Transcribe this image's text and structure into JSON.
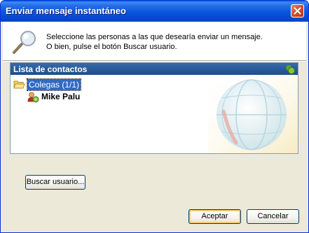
{
  "window": {
    "title": "Enviar mensaje instantáneo"
  },
  "instructions": {
    "line1": "Seleccione las personas a las que desearía enviar un mensaje.",
    "line2": "O bien, pulse el botón Buscar usuario."
  },
  "contacts": {
    "header": "Lista de contactos",
    "groups": [
      {
        "label": "Colegas (1/1)",
        "contacts": [
          {
            "name": "Mike Palu"
          }
        ]
      }
    ]
  },
  "buttons": {
    "search": "Buscar usuario...",
    "accept": "Aceptar",
    "cancel": "Cancelar"
  },
  "colors": {
    "titlebar": "#0855dd",
    "panel_header": "#2a5a9a",
    "selection": "#316ac5",
    "dialog_bg": "#ece9d8"
  },
  "icons": [
    "close-icon",
    "magnifier-icon",
    "online-status-icon",
    "folder-open-icon",
    "user-online-icon",
    "globe-watermark-icon"
  ]
}
